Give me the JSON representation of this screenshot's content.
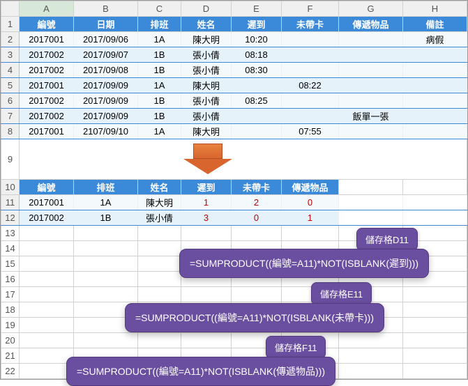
{
  "columns": [
    "A",
    "B",
    "C",
    "D",
    "E",
    "F",
    "G",
    "H"
  ],
  "rows": [
    "1",
    "2",
    "3",
    "4",
    "5",
    "6",
    "7",
    "8",
    "9",
    "10",
    "11",
    "12",
    "13",
    "14",
    "15",
    "16",
    "17",
    "18",
    "19",
    "20",
    "21",
    "22"
  ],
  "table1": {
    "headers": [
      "編號",
      "日期",
      "排班",
      "姓名",
      "遲到",
      "未帶卡",
      "傳遞物品",
      "備註"
    ],
    "rows": [
      [
        "2017001",
        "2017/09/06",
        "1A",
        "陳大明",
        "10:20",
        "",
        "",
        "病假"
      ],
      [
        "2017002",
        "2017/09/07",
        "1B",
        "張小倩",
        "08:18",
        "",
        "",
        ""
      ],
      [
        "2017002",
        "2017/09/08",
        "1B",
        "張小倩",
        "08:30",
        "",
        "",
        ""
      ],
      [
        "2017001",
        "2017/09/09",
        "1A",
        "陳大明",
        "",
        "08:22",
        "",
        ""
      ],
      [
        "2017002",
        "2017/09/09",
        "1B",
        "張小倩",
        "08:25",
        "",
        "",
        ""
      ],
      [
        "2017002",
        "2017/09/09",
        "1B",
        "張小倩",
        "",
        "",
        "飯單一張",
        ""
      ],
      [
        "2017001",
        "2107/09/10",
        "1A",
        "陳大明",
        "",
        "07:55",
        "",
        ""
      ]
    ]
  },
  "table2": {
    "headers": [
      "編號",
      "排班",
      "姓名",
      "遲到",
      "未帶卡",
      "傳遞物品"
    ],
    "rows": [
      [
        "2017001",
        "1A",
        "陳大明",
        "1",
        "2",
        "0"
      ],
      [
        "2017002",
        "1B",
        "張小倩",
        "3",
        "0",
        "1"
      ]
    ]
  },
  "callouts": {
    "d11": {
      "tag": "儲存格D11",
      "formula": "=SUMPRODUCT((編號=A11)*NOT(ISBLANK(遲到)))"
    },
    "e11": {
      "tag": "儲存格E11",
      "formula": "=SUMPRODUCT((編號=A11)*NOT(ISBLANK(未帶卡)))"
    },
    "f11": {
      "tag": "儲存格F11",
      "formula": "=SUMPRODUCT((編號=A11)*NOT(ISBLANK(傳遞物品)))"
    }
  }
}
